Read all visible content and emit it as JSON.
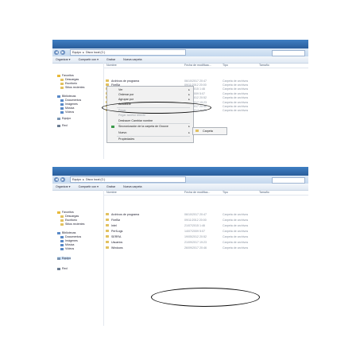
{
  "windows": [
    {
      "address": [
        "Equipo",
        "Disco local (C:)"
      ],
      "toolbar": [
        "Organizar ▾",
        "Compartir con ▾",
        "Grabar",
        "Nueva carpeta"
      ],
      "columns": [
        "Nombre",
        "Fecha de modificac...",
        "Tipo",
        "Tamaño"
      ],
      "sidebar": [
        {
          "label": "Favoritos",
          "icon": "star-icon"
        },
        {
          "label": "Descargas",
          "icon": "folder-icon"
        },
        {
          "label": "Escritorio",
          "icon": "folder-icon"
        },
        {
          "label": "Sitios recientes",
          "icon": "folder-icon"
        },
        {
          "label": "Bibliotecas",
          "icon": "library-icon"
        },
        {
          "label": "Documentos",
          "icon": "library-icon"
        },
        {
          "label": "Imágenes",
          "icon": "library-icon"
        },
        {
          "label": "Música",
          "icon": "library-icon"
        },
        {
          "label": "Vídeos",
          "icon": "library-icon"
        },
        {
          "label": "Equipo",
          "icon": "computer-icon"
        },
        {
          "label": "Red",
          "icon": "network-icon"
        }
      ],
      "rows": [
        {
          "name": "Archivos de programa",
          "date": "06/10/2017 20:47",
          "type": "Carpeta de archivos"
        },
        {
          "name": "FireBiz",
          "date": "09/11/2012 20:00",
          "type": "Carpeta de archivos"
        },
        {
          "name": "Intel",
          "date": "21/07/2015 1:46",
          "type": "Carpeta de archivos"
        },
        {
          "name": "PerfLogs",
          "date": "14/07/2009 5:07",
          "type": "Carpeta de archivos"
        },
        {
          "name": "SERRA",
          "date": "19/05/2012 20:52",
          "type": "Carpeta de archivos"
        },
        {
          "name": "Usuarios",
          "date": "21/09/2017 19:23",
          "type": "Carpeta de archivos"
        },
        {
          "name": "Windows",
          "date": "26/09/2017 20:46",
          "type": "Carpeta de archivos"
        },
        {
          "name": "Nehuelo",
          "date": "24/03/2017 20:20",
          "type": "Carpeta de archivos"
        }
      ]
    },
    {
      "address": [
        "Equipo",
        "Disco local (C:)"
      ],
      "toolbar": [
        "Organizar ▾",
        "Compartir con ▾",
        "Grabar",
        "Nueva carpeta"
      ],
      "columns": [
        "Nombre",
        "Fecha de modifica...",
        "Tipo",
        "Tamaño"
      ],
      "sidebar": [
        {
          "label": "Favoritos",
          "icon": "star-icon"
        },
        {
          "label": "Descargas",
          "icon": "folder-icon"
        },
        {
          "label": "Escritorio",
          "icon": "folder-icon"
        },
        {
          "label": "Sitios recientes",
          "icon": "folder-icon"
        },
        {
          "label": "Bibliotecas",
          "icon": "library-icon"
        },
        {
          "label": "Documentos",
          "icon": "library-icon"
        },
        {
          "label": "Imágenes",
          "icon": "library-icon"
        },
        {
          "label": "Música",
          "icon": "library-icon"
        },
        {
          "label": "Vídeos",
          "icon": "library-icon"
        },
        {
          "label": "Equipo",
          "icon": "computer-icon"
        },
        {
          "label": "Red",
          "icon": "network-icon"
        }
      ],
      "rows": [
        {
          "name": "Archivos de programa",
          "date": "06/10/2017 20:47",
          "type": "Carpeta de archivos"
        },
        {
          "name": "FireBiz",
          "date": "09/11/2012 20:00",
          "type": "Carpeta de archivos"
        },
        {
          "name": "Intel",
          "date": "21/07/2015 1:46",
          "type": "Carpeta de archivos"
        },
        {
          "name": "PerfLogs",
          "date": "14/07/2009 5:07",
          "type": "Carpeta de archivos"
        },
        {
          "name": "SERRA",
          "date": "19/05/2012 20:52",
          "type": "Carpeta de archivos"
        },
        {
          "name": "Usuarios",
          "date": "21/09/2017 19:23",
          "type": "Carpeta de archivos"
        },
        {
          "name": "Windows",
          "date": "26/09/2017 20:46",
          "type": "Carpeta de archivos"
        }
      ]
    }
  ],
  "context_menu": {
    "items": [
      {
        "label": "Ver",
        "arrow": true,
        "disabled": false
      },
      {
        "label": "Ordenar por",
        "arrow": true,
        "disabled": false
      },
      {
        "label": "Agrupar por",
        "arrow": true,
        "disabled": false
      },
      {
        "label": "Actualizar",
        "arrow": false,
        "disabled": false
      },
      {
        "label": "Pegar",
        "arrow": false,
        "disabled": true
      },
      {
        "label": "Pegar acceso directo",
        "arrow": false,
        "disabled": true
      },
      {
        "label": "Deshacer Cambiar nombre",
        "arrow": false,
        "disabled": false
      },
      {
        "label": "Sincronización de la carpeta de Groove",
        "arrow": true,
        "disabled": false
      },
      {
        "label": "Nuevo",
        "arrow": true,
        "disabled": false
      },
      {
        "label": "Propiedades",
        "arrow": false,
        "disabled": false
      }
    ],
    "submenu_item": "Carpeta"
  },
  "colors": {
    "titlebar": "#2a5d9b",
    "folder": "#e2c15f",
    "selection": "#cfe3f8",
    "annotation": "#111111"
  }
}
